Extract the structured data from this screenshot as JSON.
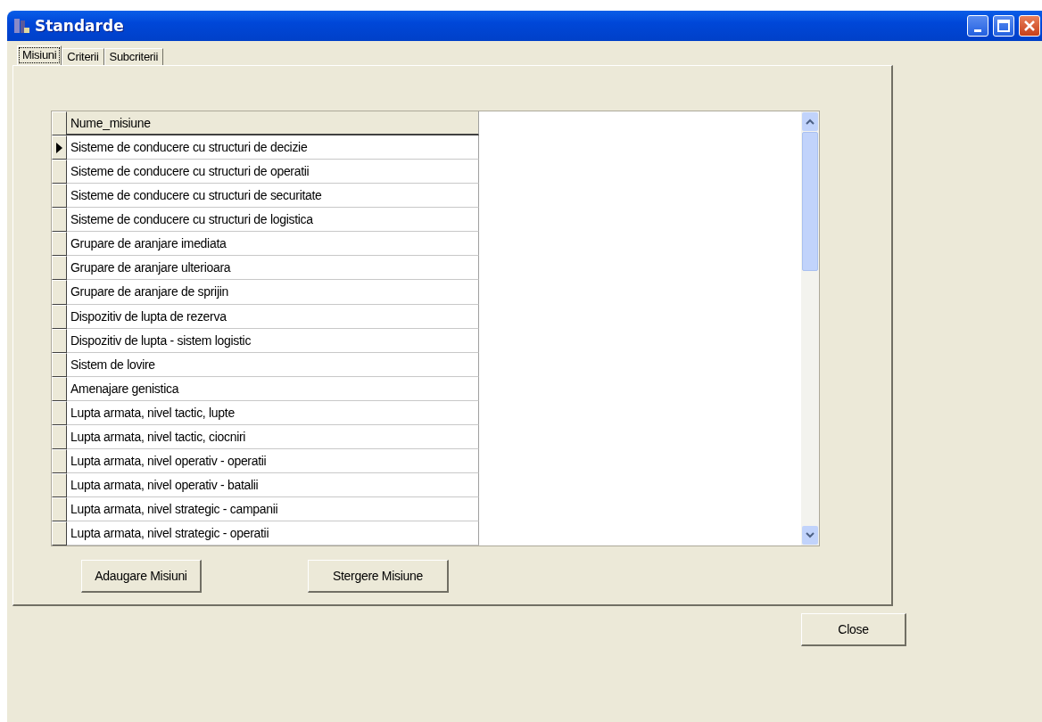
{
  "window": {
    "title": "Standarde"
  },
  "tabs": [
    {
      "label": "Misiuni",
      "selected": true
    },
    {
      "label": "Criterii",
      "selected": false
    },
    {
      "label": "Subcriterii",
      "selected": false
    }
  ],
  "table": {
    "columns": [
      "Nume_misiune"
    ],
    "rows": [
      {
        "name": "Sisteme de conducere cu structuri de decizie",
        "selected": true
      },
      {
        "name": "Sisteme de conducere cu structuri de operatii",
        "selected": false
      },
      {
        "name": "Sisteme de conducere cu structuri de securitate",
        "selected": false
      },
      {
        "name": "Sisteme de conducere cu structuri de logistica",
        "selected": false
      },
      {
        "name": "Grupare de aranjare imediata",
        "selected": false
      },
      {
        "name": "Grupare de aranjare ulterioara",
        "selected": false
      },
      {
        "name": "Grupare de aranjare de sprijin",
        "selected": false
      },
      {
        "name": "Dispozitiv de lupta de rezerva",
        "selected": false
      },
      {
        "name": "Dispozitiv de lupta - sistem logistic",
        "selected": false
      },
      {
        "name": "Sistem de lovire",
        "selected": false
      },
      {
        "name": "Amenajare genistica",
        "selected": false
      },
      {
        "name": "Lupta armata, nivel tactic, lupte",
        "selected": false
      },
      {
        "name": "Lupta armata, nivel tactic, ciocniri",
        "selected": false
      },
      {
        "name": "Lupta armata, nivel operativ - operatii",
        "selected": false
      },
      {
        "name": "Lupta armata, nivel operativ - batalii",
        "selected": false
      },
      {
        "name": "Lupta armata, nivel strategic - campanii",
        "selected": false
      },
      {
        "name": "Lupta armata, nivel strategic - operatii",
        "selected": false
      }
    ]
  },
  "panel_buttons": [
    "Adaugare Misiuni",
    "Stergere Misiune"
  ],
  "close_button": "Close"
}
